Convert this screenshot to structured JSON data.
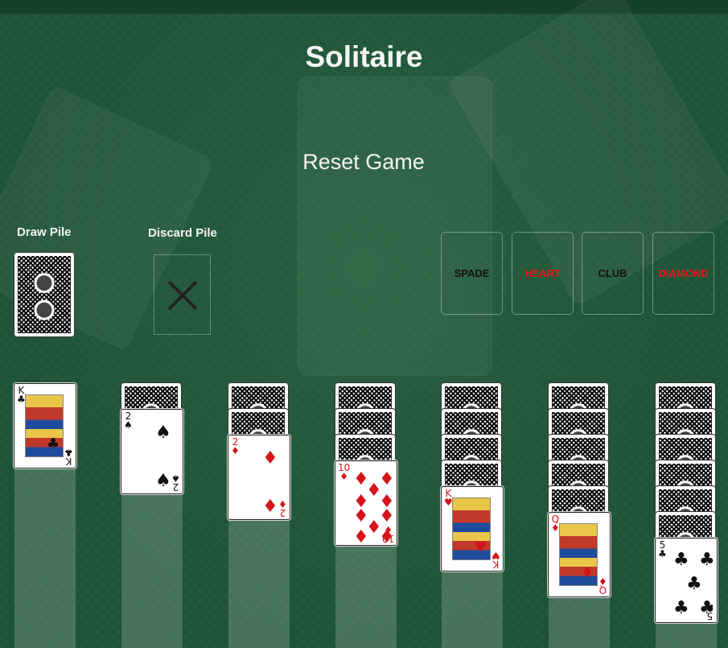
{
  "title": "Solitaire",
  "reset_label": "Reset Game",
  "draw_pile": {
    "label": "Draw Pile"
  },
  "discard_pile": {
    "label": "Discard Pile",
    "empty_icon": "x-icon"
  },
  "foundations": [
    {
      "label": "SPADE",
      "color": "#111111"
    },
    {
      "label": "HEART",
      "color": "#e01b1b"
    },
    {
      "label": "CLUB",
      "color": "#111111"
    },
    {
      "label": "DIAMOND",
      "color": "#e01b1b"
    }
  ],
  "tableau": [
    {
      "face_down": 0,
      "top": {
        "rank": "K",
        "suit": "♣",
        "color": "black"
      }
    },
    {
      "face_down": 1,
      "top": {
        "rank": "2",
        "suit": "♠",
        "color": "black"
      }
    },
    {
      "face_down": 2,
      "top": {
        "rank": "2",
        "suit": "♦",
        "color": "red"
      }
    },
    {
      "face_down": 3,
      "top": {
        "rank": "10",
        "suit": "♦",
        "color": "red"
      }
    },
    {
      "face_down": 4,
      "top": {
        "rank": "K",
        "suit": "♥",
        "color": "red"
      }
    },
    {
      "face_down": 5,
      "top": {
        "rank": "Q",
        "suit": "♦",
        "color": "red"
      }
    },
    {
      "face_down": 6,
      "top": {
        "rank": "5",
        "suit": "♣",
        "color": "black"
      }
    }
  ]
}
